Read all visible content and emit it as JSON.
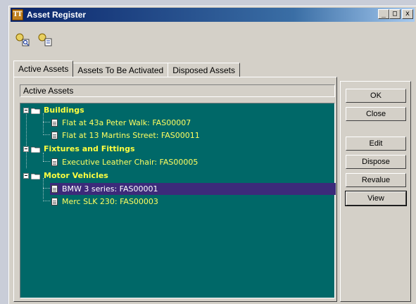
{
  "window": {
    "title": "Asset Register",
    "app_icon": "TT",
    "controls": {
      "minimize": "_",
      "maximize": "□",
      "close": "x"
    }
  },
  "toolbar": {
    "buttons": [
      {
        "icon": "asset-search-icon"
      },
      {
        "icon": "asset-find-icon"
      }
    ]
  },
  "tabs": [
    {
      "label": "Active Assets",
      "active": true
    },
    {
      "label": "Assets To Be Activated",
      "active": false
    },
    {
      "label": "Disposed Assets",
      "active": false
    }
  ],
  "panel": {
    "label": "Active Assets"
  },
  "tree": {
    "groups": [
      {
        "label": "Buildings",
        "items": [
          {
            "label": "Flat at 43a Peter Walk: FAS00007"
          },
          {
            "label": "Flat at 13 Martins Street: FAS00011"
          }
        ]
      },
      {
        "label": "Fixtures and Fittings",
        "items": [
          {
            "label": "Executive Leather Chair: FAS00005"
          }
        ]
      },
      {
        "label": "Motor Vehicles",
        "items": [
          {
            "label": "BMW 3 series: FAS00001",
            "selected": true
          },
          {
            "label": "Merc SLK 230: FAS00003"
          }
        ]
      }
    ]
  },
  "buttons": {
    "ok": "OK",
    "close": "Close",
    "edit": "Edit",
    "dispose": "Dispose",
    "revalue": "Revalue",
    "view": "View"
  },
  "colors": {
    "tree_background": "#006868",
    "group_text": "#ffff40",
    "selected_background": "#3c2a7a",
    "titlebar": "#0a246a"
  }
}
